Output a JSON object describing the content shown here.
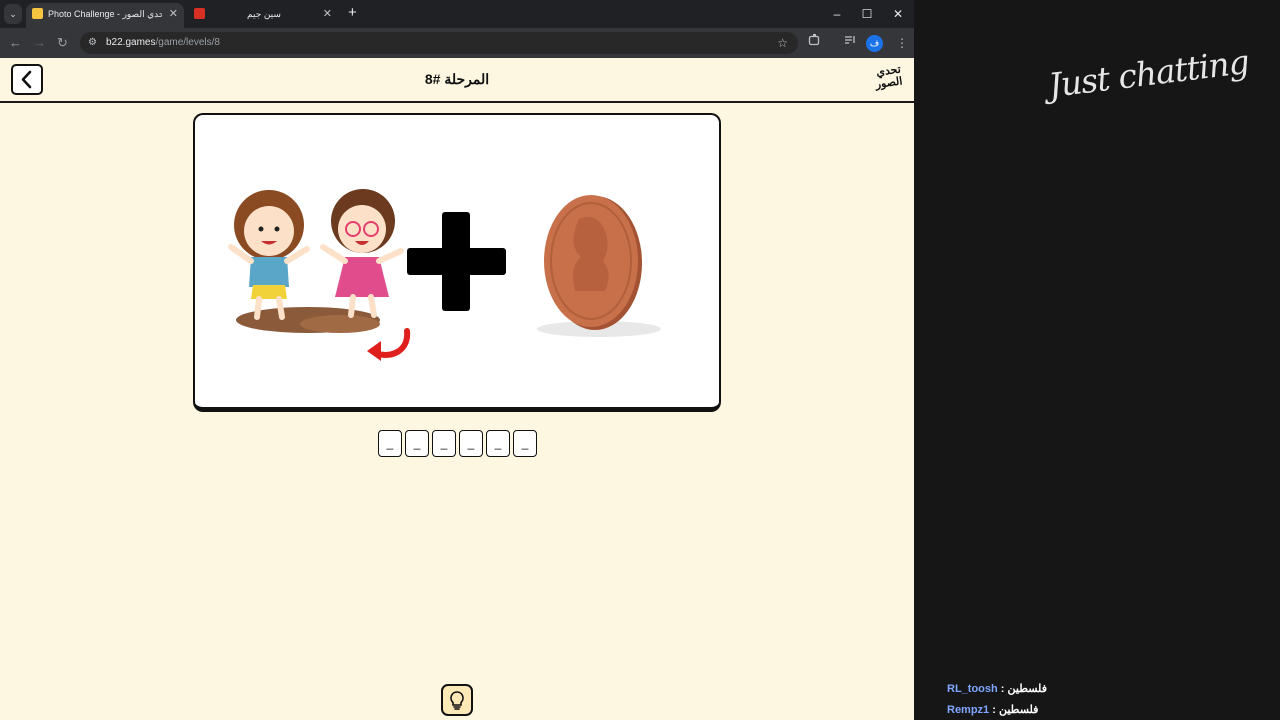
{
  "browser": {
    "tabs": [
      {
        "title": "Photo Challenge - تحدي الصور",
        "active": true
      },
      {
        "title": "سين جيم",
        "active": false
      }
    ],
    "new_tab_label": "+",
    "url": {
      "host": "b22.games",
      "path": "/game/levels/8"
    },
    "window_controls": {
      "minimize": "–",
      "maximize": "☐",
      "close": "✕"
    },
    "profile_initial": "ف"
  },
  "game": {
    "level_title": "المرحلة #8",
    "logo_text": "تحدي الصور",
    "answer_slots": [
      "_",
      "_",
      "_",
      "_",
      "_",
      "_"
    ],
    "colors": {
      "background": "#fdf6e1",
      "coin": "#c8704a",
      "arrow": "#e0201c",
      "hint_button": "#fde9b8"
    }
  },
  "stream": {
    "overlay_title": "Just chatting",
    "chat": [
      {
        "user": "RL_toosh",
        "message": "فلسطين"
      },
      {
        "user": "Rempz1",
        "message": "فلسطين"
      }
    ]
  }
}
